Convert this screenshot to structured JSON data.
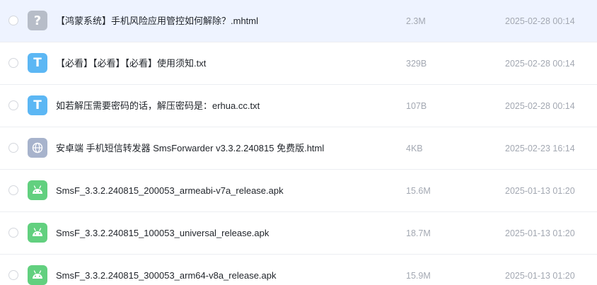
{
  "files": [
    {
      "name": "【鸿蒙系统】手机风险应用管控如何解除？.mhtml",
      "size": "2.3M",
      "date": "2025-02-28 00:14",
      "icon": "unknown-file-icon",
      "icon_glyph": "?",
      "selected": true
    },
    {
      "name": "【必看】【必看】【必看】使用须知.txt",
      "size": "329B",
      "date": "2025-02-28 00:14",
      "icon": "text-file-icon",
      "icon_glyph": "T"
    },
    {
      "name": "如若解压需要密码的话，解压密码是：erhua.cc.txt",
      "size": "107B",
      "date": "2025-02-28 00:14",
      "icon": "text-file-icon",
      "icon_glyph": "T"
    },
    {
      "name": "安卓端 手机短信转发器 SmsForwarder v3.3.2.240815 免费版.html",
      "size": "4KB",
      "date": "2025-02-23 16:14",
      "icon": "globe-icon"
    },
    {
      "name": "SmsF_3.3.2.240815_200053_armeabi-v7a_release.apk",
      "size": "15.6M",
      "date": "2025-01-13 01:20",
      "icon": "android-icon"
    },
    {
      "name": "SmsF_3.3.2.240815_100053_universal_release.apk",
      "size": "18.7M",
      "date": "2025-01-13 01:20",
      "icon": "android-icon"
    },
    {
      "name": "SmsF_3.3.2.240815_300053_arm64-v8a_release.apk",
      "size": "15.9M",
      "date": "2025-01-13 01:20",
      "icon": "android-icon"
    }
  ]
}
